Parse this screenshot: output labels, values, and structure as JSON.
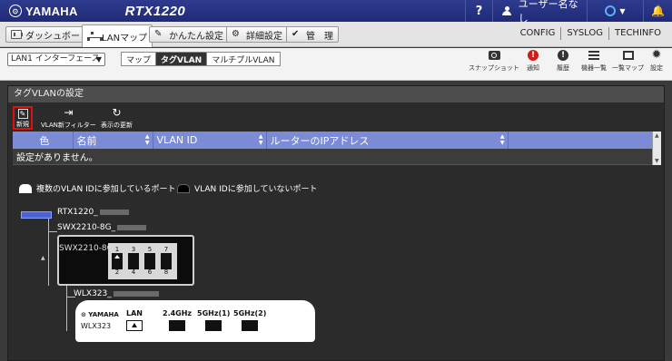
{
  "header": {
    "brand": "YAMAHA",
    "model": "RTX1220",
    "help": "?",
    "user": "ユーザー名なし",
    "bell": "🔔"
  },
  "tabs": [
    {
      "label": "ダッシュボード",
      "icon": "dashboard-icon"
    },
    {
      "label": "LANマップ",
      "icon": "network-icon",
      "active": true
    },
    {
      "label": "かんたん設定",
      "icon": "wand-icon"
    },
    {
      "label": "詳細設定",
      "icon": "settings-icon"
    },
    {
      "label": "管　理",
      "icon": "wrench-icon"
    }
  ],
  "header_links": [
    "CONFIG",
    "SYSLOG",
    "TECHINFO"
  ],
  "subbar": {
    "interface": "LAN1 インターフェース",
    "views": [
      "マップ",
      "タグVLAN",
      "マルチプルVLAN"
    ],
    "active_view": "タグVLAN",
    "tools": [
      {
        "label": "スナップショット",
        "icon": "camera-icon"
      },
      {
        "label": "通知",
        "icon": "alert-icon",
        "glyph": "!"
      },
      {
        "label": "履歴",
        "icon": "history-icon",
        "glyph": "!"
      },
      {
        "label": "機器一覧",
        "icon": "list-icon"
      },
      {
        "label": "一覧マップ",
        "icon": "map-icon"
      },
      {
        "label": "設定",
        "icon": "gear-icon"
      }
    ]
  },
  "panel": {
    "title": "タグVLANの設定",
    "buttons": [
      {
        "label": "新規",
        "icon": "new-icon"
      },
      {
        "label": "VLAN新フィルター",
        "icon": "filter-icon"
      },
      {
        "label": "表示の更新",
        "icon": "refresh-icon"
      }
    ],
    "table": {
      "columns": [
        "色",
        "名前",
        "VLAN ID",
        "ルーターのIPアドレス"
      ],
      "empty_message": "設定がありません。"
    },
    "legend": [
      {
        "label": "複数のVLAN IDに参加しているポート",
        "color": "#ffffff"
      },
      {
        "label": "VLAN IDに参加していないポート",
        "color": "#000000"
      }
    ]
  },
  "topology": {
    "router": "RTX1220_",
    "switch": {
      "name": "SWX2210-8G_",
      "model": "SWX2210-8G",
      "ports_top": [
        "1",
        "3",
        "5",
        "7"
      ],
      "ports_bottom": [
        "2",
        "4",
        "6",
        "8"
      ]
    },
    "ap": {
      "name": "WLX323_",
      "brand": "⊙ YAMAHA",
      "model": "WLX323",
      "ports": [
        "LAN",
        "2.4GHz",
        "5GHz(1)",
        "5GHz(2)"
      ]
    }
  },
  "colors": {
    "header": "#1f2a78",
    "table_header": "#7b8bd6",
    "router": "#4b63d6",
    "highlight": "#e01010"
  }
}
